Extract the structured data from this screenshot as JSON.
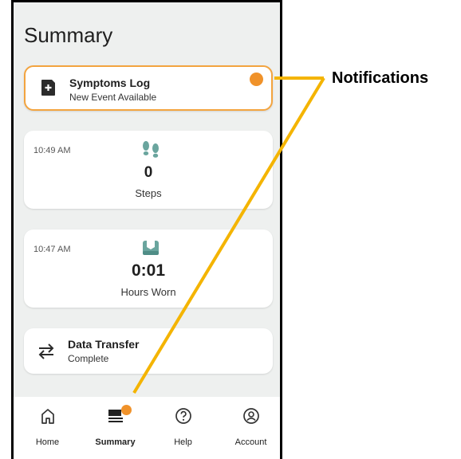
{
  "page": {
    "title": "Summary"
  },
  "cards": {
    "symptoms": {
      "title": "Symptoms Log",
      "subtitle": "New Event Available"
    },
    "steps": {
      "time": "10:49 AM",
      "value": "0",
      "unit": "Steps"
    },
    "worn": {
      "time": "10:47 AM",
      "value": "0:01",
      "unit": "Hours Worn"
    },
    "transfer": {
      "title": "Data Transfer",
      "subtitle": "Complete"
    }
  },
  "nav": {
    "items": [
      {
        "label": "Home",
        "icon": "home-icon"
      },
      {
        "label": "Summary",
        "icon": "summary-icon",
        "active": true
      },
      {
        "label": "Help",
        "icon": "help-icon"
      },
      {
        "label": "Account",
        "icon": "account-icon"
      }
    ]
  },
  "annotation": {
    "label": "Notifications",
    "color": "#f4b400"
  },
  "colors": {
    "accent_orange": "#f0922a",
    "highlight_border": "#f3a43f",
    "icon_teal": "#6aa59e"
  }
}
